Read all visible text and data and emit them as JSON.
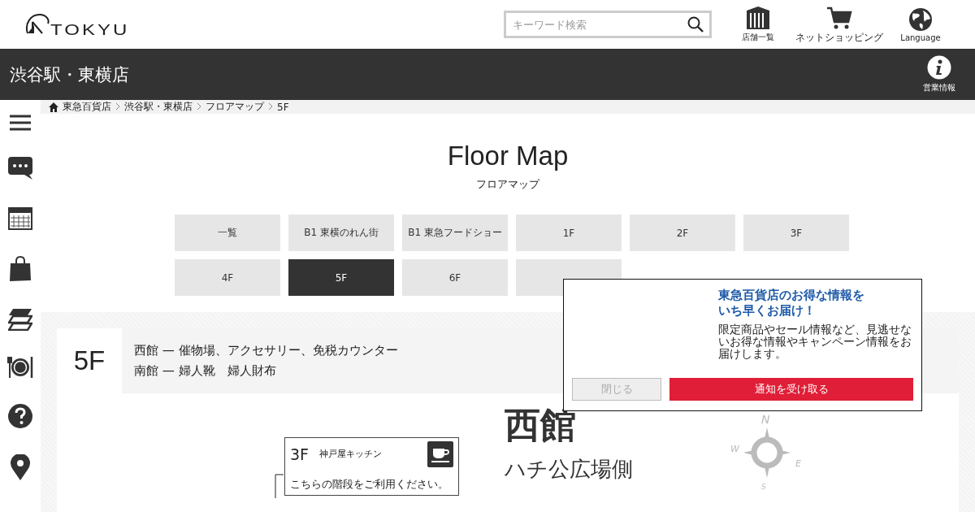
{
  "header": {
    "logo": "TOKYU",
    "search": {
      "placeholder": "キーワード検索"
    },
    "links": [
      {
        "kind": "stores",
        "label": "店舗一覧"
      },
      {
        "kind": "cart",
        "label": "ネットショッピング"
      },
      {
        "kind": "language",
        "label": "Language"
      }
    ]
  },
  "store_bar": {
    "title": "渋谷駅・東横店",
    "info_label": "営業情報"
  },
  "breadcrumb": [
    "東急百貨店",
    "渋谷駅・東横店",
    "フロアマップ",
    "5F"
  ],
  "sidebar": [
    {
      "kind": "menu"
    },
    {
      "kind": "chat"
    },
    {
      "kind": "calendar"
    },
    {
      "kind": "bag"
    },
    {
      "kind": "layers"
    },
    {
      "kind": "dining"
    },
    {
      "kind": "help"
    },
    {
      "kind": "pin"
    }
  ],
  "page": {
    "title": "Floor Map",
    "subtitle": "フロアマップ"
  },
  "floors": [
    {
      "label": "一覧",
      "selected": false
    },
    {
      "label": "B1 東横のれん街",
      "selected": false
    },
    {
      "label": "B1 東急フードショー",
      "selected": false
    },
    {
      "label": "1F",
      "selected": false
    },
    {
      "label": "2F",
      "selected": false
    },
    {
      "label": "3F",
      "selected": false
    },
    {
      "label": "4F",
      "selected": false
    },
    {
      "label": "5F",
      "selected": true
    },
    {
      "label": "6F",
      "selected": false
    },
    {
      "kind": "covered",
      "selected": false
    }
  ],
  "floor_info": {
    "floor": "5F",
    "lines": [
      "西館 — 催物場、アクセサリー、免税カウンター",
      "南館 — 婦人靴　婦人財布"
    ]
  },
  "map": {
    "sign": {
      "floor": "3F",
      "name": "神戸屋キッチン",
      "note": "こちらの階段をご利用ください。"
    },
    "building": "西館",
    "side": "ハチ公広場側",
    "compass": [
      "N",
      "W",
      "E",
      "S"
    ]
  },
  "popup": {
    "heading": [
      "東急百貨店のお得な情報を",
      "いち早くお届け！"
    ],
    "body": "限定商品やセール情報など、見逃せないお得な情報やキャンペーン情報をお届けします。",
    "close": "閉じる",
    "accept": "通知を受け取る"
  }
}
